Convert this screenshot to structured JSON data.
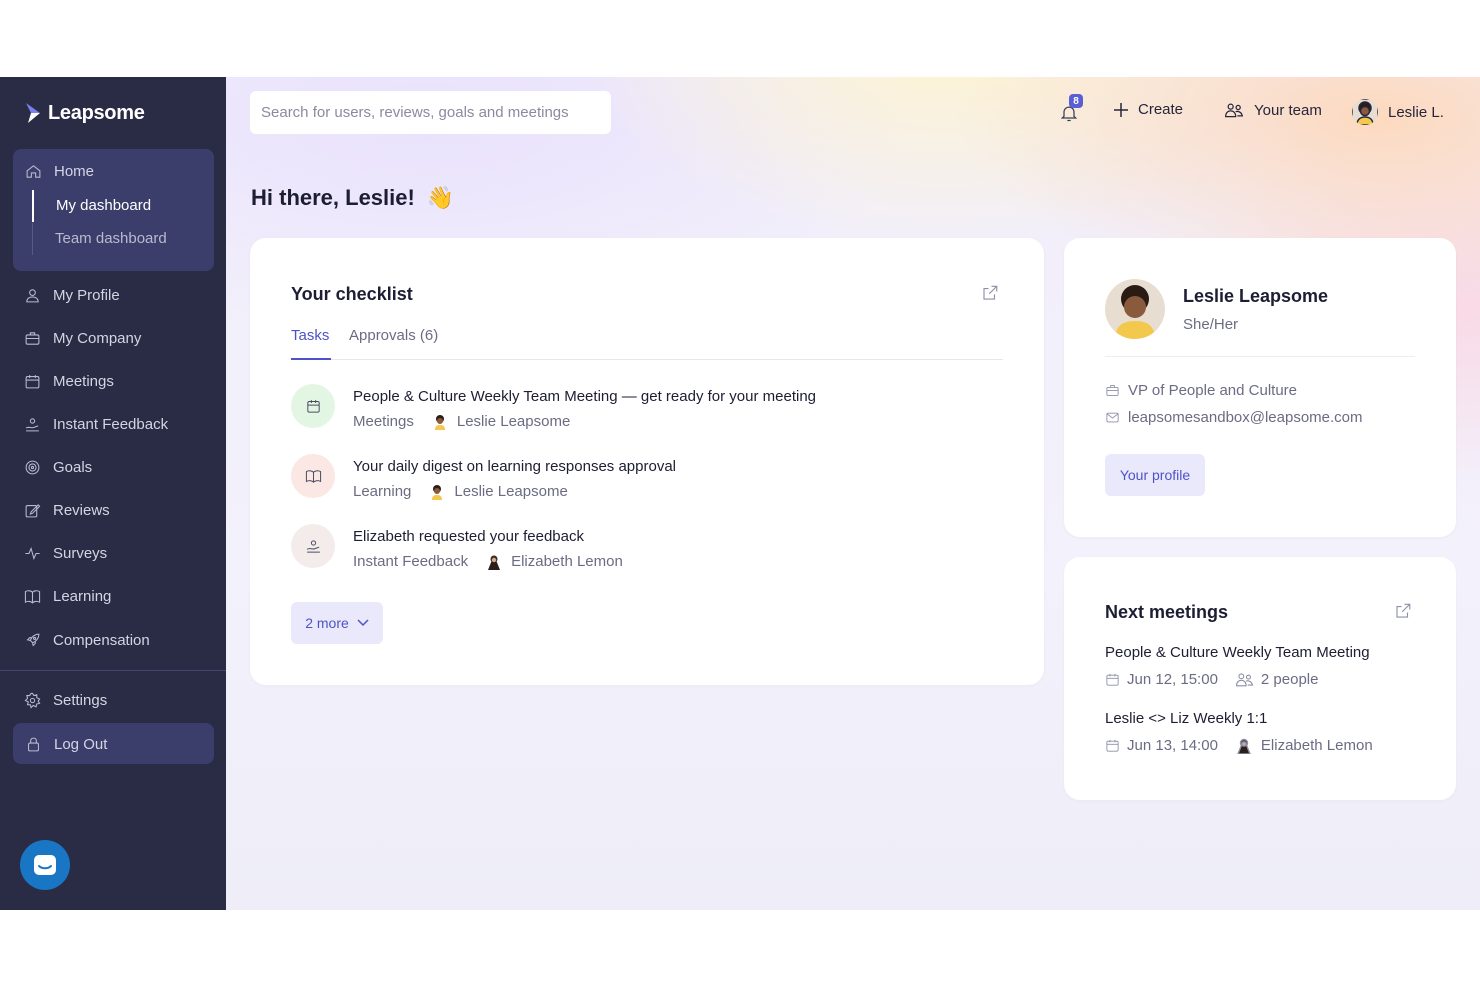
{
  "brand": {
    "name": "Leapsome"
  },
  "sidebar": {
    "home": {
      "label": "Home",
      "sub": [
        {
          "label": "My dashboard"
        },
        {
          "label": "Team dashboard"
        }
      ]
    },
    "items": [
      {
        "label": "My Profile",
        "icon": "user-icon"
      },
      {
        "label": "My Company",
        "icon": "briefcase-icon"
      },
      {
        "label": "Meetings",
        "icon": "calendar-icon"
      },
      {
        "label": "Instant Feedback",
        "icon": "feedback-icon"
      },
      {
        "label": "Goals",
        "icon": "target-icon"
      },
      {
        "label": "Reviews",
        "icon": "edit-icon"
      },
      {
        "label": "Surveys",
        "icon": "pulse-icon"
      },
      {
        "label": "Learning",
        "icon": "book-icon"
      },
      {
        "label": "Compensation",
        "icon": "rocket-icon"
      }
    ],
    "settings": {
      "label": "Settings"
    },
    "logout": {
      "label": "Log Out"
    }
  },
  "topbar": {
    "search_placeholder": "Search for users, reviews, goals and meetings",
    "notifications_count": "8",
    "create_label": "Create",
    "team_label": "Your team",
    "user_label": "Leslie L."
  },
  "greeting": {
    "text": "Hi there, Leslie!",
    "emoji": "👋"
  },
  "checklist": {
    "title": "Your checklist",
    "tabs": [
      {
        "label": "Tasks"
      },
      {
        "label": "Approvals (6)"
      }
    ],
    "tasks": [
      {
        "title": "People & Culture Weekly Team Meeting — get ready for your meeting",
        "category": "Meetings",
        "person": "Leslie Leapsome",
        "icon": "calendar-icon"
      },
      {
        "title": "Your daily digest on learning responses approval",
        "category": "Learning",
        "person": "Leslie Leapsome",
        "icon": "book-icon"
      },
      {
        "title": "Elizabeth requested your feedback",
        "category": "Instant Feedback",
        "person": "Elizabeth Lemon",
        "icon": "feedback-icon"
      }
    ],
    "more_label": "2 more"
  },
  "profile": {
    "name": "Leslie Leapsome",
    "pronouns": "She/Her",
    "role": "VP of People and Culture",
    "email": "leapsomesandbox@leapsome.com",
    "button_label": "Your profile"
  },
  "meetings": {
    "title": "Next meetings",
    "items": [
      {
        "title": "People & Culture Weekly Team Meeting",
        "date": "Jun 12, 15:00",
        "attendees": "2 people"
      },
      {
        "title": "Leslie <> Liz Weekly 1:1",
        "date": "Jun 13, 14:00",
        "attendees": "Elizabeth Lemon"
      }
    ]
  },
  "colors": {
    "sidebar_bg": "#2a2b45",
    "accent": "#4e52c8",
    "badge": "#5b5fd6"
  }
}
